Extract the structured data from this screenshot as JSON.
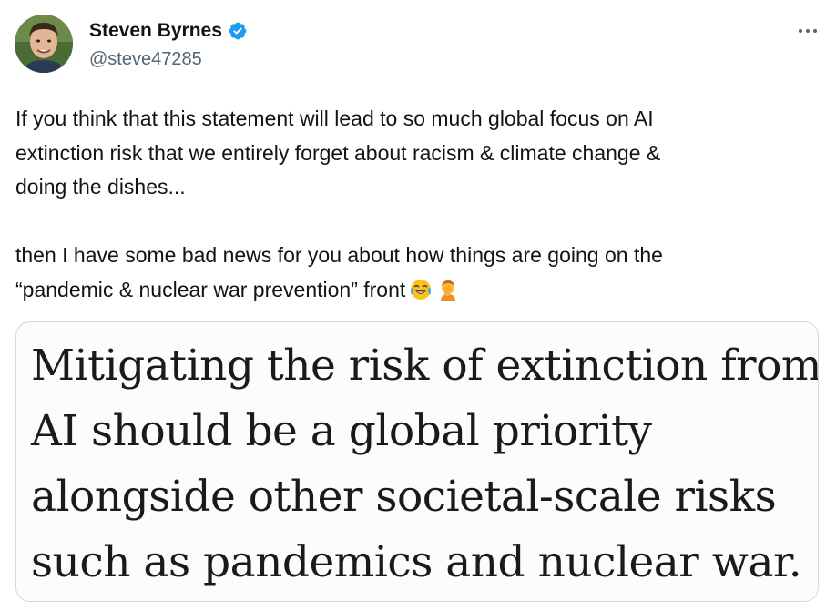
{
  "author": {
    "display_name": "Steven Byrnes",
    "handle": "@steve47285",
    "verified": true,
    "avatar_icon": "profile-photo"
  },
  "more_icon": "ellipsis-icon",
  "tweet": {
    "paragraph1_lines": [
      "If you think that this statement will lead to so much global focus on AI",
      "extinction risk that we entirely forget about racism & climate change &",
      "doing the dishes..."
    ],
    "paragraph2_lines": [
      "then I have some bad news for you about how things are going on the",
      "“pandemic & nuclear war prevention” front"
    ],
    "emojis": [
      "face-with-tears-of-joy",
      "person-facepalming"
    ]
  },
  "media": {
    "quote_lines": [
      "Mitigating the risk of extinction from",
      "AI should be a global priority",
      "alongside other societal-scale risks",
      "such as pandemics and nuclear war."
    ]
  },
  "colors": {
    "text_primary": "#0f1419",
    "text_secondary": "#536471",
    "verified_blue": "#1d9bf0",
    "card_border": "#cfd9de"
  }
}
